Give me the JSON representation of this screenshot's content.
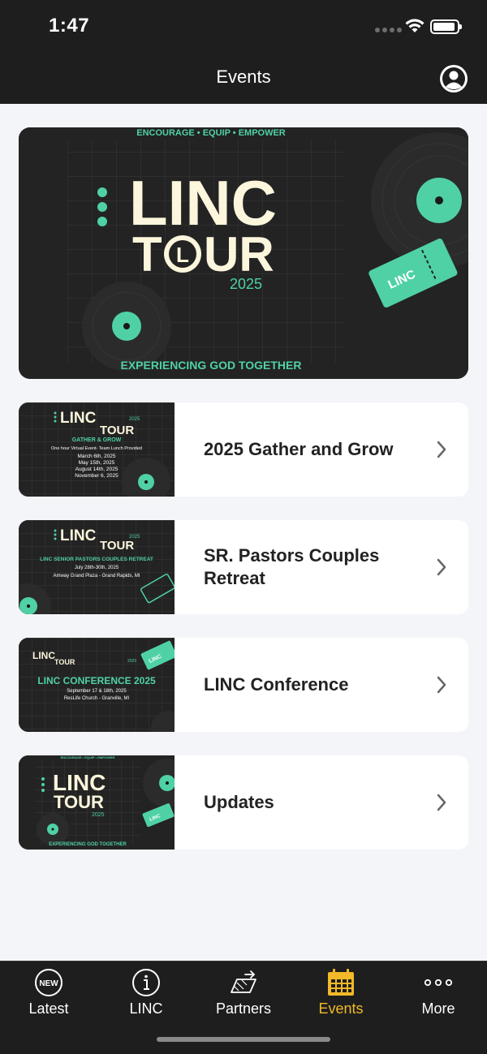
{
  "status_bar": {
    "time": "1:47"
  },
  "nav": {
    "title": "Events"
  },
  "hero": {
    "tagline": "ENCOURAGE • EQUIP • EMPOWER",
    "logo_line1": "LINC",
    "logo_line2_pre": "T",
    "logo_line2_post": "UR",
    "year": "2025",
    "footer": "EXPERIENCING GOD TOGETHER",
    "ticket_text": "LINC",
    "logo_mark": "L"
  },
  "events": [
    {
      "label": "2025 Gather and Grow",
      "thumb": {
        "logo1": "LINC",
        "logo2": "TOUR",
        "year": "2025",
        "subtitle": "GATHER & GROW",
        "line1": "One hour Virtual Event- Team Lunch Provided",
        "line2": "March 6th, 2025",
        "line3": "May 15th, 2025",
        "line4": "August 14th, 2025",
        "line5": "November 6, 2025"
      }
    },
    {
      "label": "SR. Pastors Couples Retreat",
      "thumb": {
        "logo1": "LINC",
        "logo2": "TOUR",
        "year": "2025",
        "subtitle": "LINC SENIOR PASTORS COUPLES RETREAT",
        "line1": "July 28th-30th, 2025",
        "line2": "Amway Grand Plaza - Grand Rapids, MI"
      }
    },
    {
      "label": "LINC Conference",
      "thumb": {
        "logo1": "LINC",
        "logo2": "TOUR",
        "year": "2025",
        "subtitle": "LINC CONFERENCE 2025",
        "line1": "September 17 & 18th, 2025",
        "line2": "ResLife Church - Granville, MI",
        "ticket_text": "LINC"
      }
    },
    {
      "label": "Updates",
      "thumb": {
        "tagline": "ENCOURAGE • EQUIP • EMPOWER",
        "logo1": "LINC",
        "logo2": "TOUR",
        "year": "2025",
        "footer": "EXPERIENCING GOD TOGETHER",
        "ticket_text": "LINC",
        "logo_mark": "L"
      }
    }
  ],
  "tabs": [
    {
      "label": "Latest",
      "icon": "new-badge-icon",
      "badge": "NEW"
    },
    {
      "label": "LINC",
      "icon": "info-icon"
    },
    {
      "label": "Partners",
      "icon": "handshake-icon"
    },
    {
      "label": "Events",
      "icon": "calendar-icon",
      "active": true
    },
    {
      "label": "More",
      "icon": "more-dots-icon"
    }
  ],
  "colors": {
    "accent": "#f2b928",
    "brand_teal": "#4fd1a5",
    "cream": "#fbf6dc",
    "dark": "#1e1e1e"
  }
}
